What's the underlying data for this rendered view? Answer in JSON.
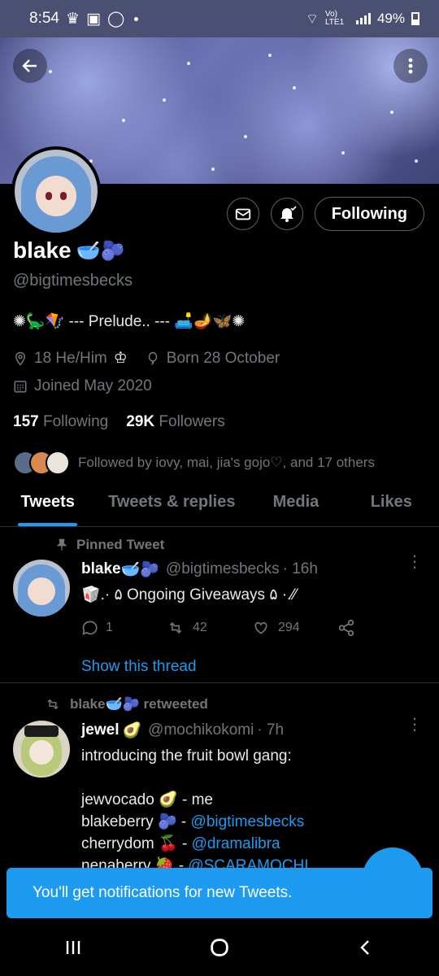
{
  "status_bar": {
    "time": "8:54",
    "network": "Vo) LTE1",
    "battery": "49%"
  },
  "profile": {
    "name": "blake",
    "name_emojis": "🥣🫐",
    "handle": "@bigtimesbecks",
    "bio": "✺🦕🪁 --- Prelude.. --- 🛋️🪔🦋✺",
    "location": "18 He/Him",
    "location_suffix": "♔",
    "birthday": "Born 28 October",
    "joined": "Joined May 2020",
    "following_count": "157",
    "following_label": "Following",
    "followers_count": "29K",
    "followers_label": "Followers",
    "followed_by": "Followed by iovy, mai, jia's gojo♡, and 17 others",
    "following_button": "Following"
  },
  "tabs": [
    "Tweets",
    "Tweets & replies",
    "Media",
    "Likes"
  ],
  "tweets": [
    {
      "context": "Pinned Tweet",
      "name": "blake",
      "name_emojis": "🥣🫐",
      "handle": "@bigtimesbecks",
      "time": "· 16h",
      "text": "🥡.· ۵ Ongoing Giveaways ۵ ·.⁄⁄",
      "reply_count": "1",
      "retweet_count": "42",
      "like_count": "294",
      "show_thread": "Show this thread"
    },
    {
      "context": "blake🥣🫐 retweeted",
      "name": "jewel",
      "name_emojis": "🥑",
      "handle": "@mochikokomi",
      "time": "· 7h",
      "line1": "introducing the fruit bowl gang:",
      "line2_text": "jewvocado 🥑 - me",
      "line3_text": "blakeberry 🫐 - ",
      "line3_link": "@bigtimesbecks",
      "line4_text": "cherrydom 🍒 - ",
      "line4_link": "@dramalibra",
      "line5_text": "nenaberry 🍓 - ",
      "line5_link": "@SCARAMOCHI"
    }
  ],
  "toast": "You'll get notifications for new Tweets.",
  "colors": {
    "accent": "#1d9bf0",
    "background": "#000000",
    "muted": "#71767b",
    "status_bar": "#4b4f72"
  }
}
